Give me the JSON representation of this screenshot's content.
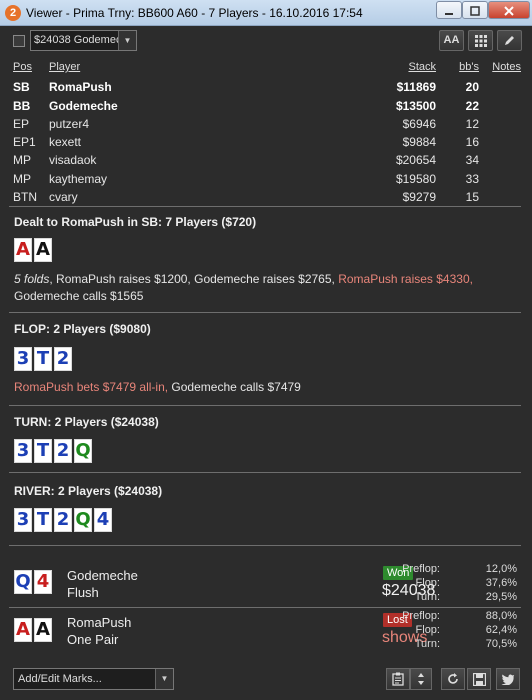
{
  "window": {
    "title": "Viewer - Prima Trny: BB600 A60 - 7 Players - 16.10.2016 17:54",
    "app_icon": "2"
  },
  "toolbar": {
    "hand_select_value": "$24038 Godemeche",
    "font_button_label": "AA"
  },
  "players_table": {
    "headers": {
      "pos": "Pos",
      "player": "Player",
      "stack": "Stack",
      "bbs": "bb's",
      "notes": "Notes"
    },
    "rows": [
      {
        "pos": "SB",
        "player": "RomaPush",
        "stack": "$11869",
        "bbs": "20",
        "bold": true
      },
      {
        "pos": "BB",
        "player": "Godemeche",
        "stack": "$13500",
        "bbs": "22",
        "bold": true
      },
      {
        "pos": "EP",
        "player": "putzer4",
        "stack": "$6946",
        "bbs": "12",
        "bold": false
      },
      {
        "pos": "EP1",
        "player": "kexett",
        "stack": "$9884",
        "bbs": "16",
        "bold": false
      },
      {
        "pos": "MP",
        "player": "visadaok",
        "stack": "$20654",
        "bbs": "34",
        "bold": false
      },
      {
        "pos": "MP",
        "player": "kaythemay",
        "stack": "$19580",
        "bbs": "33",
        "bold": false
      },
      {
        "pos": "BTN",
        "player": "cvary",
        "stack": "$9279",
        "bbs": "15",
        "bold": false
      }
    ]
  },
  "preflop": {
    "title": "Dealt to RomaPush in SB: 7 Players ($720)",
    "cards": [
      {
        "rank": "A",
        "color": "#c81e1e"
      },
      {
        "rank": "A",
        "color": "#111111"
      }
    ],
    "action_folds": "5 folds",
    "action_a": ", RomaPush raises $1200, Godemeche raises $2765, ",
    "action_hl": "RomaPush raises $4330,",
    "action_b": "Godemeche calls $1565"
  },
  "flop": {
    "title": "FLOP: 2 Players ($9080)",
    "cards": [
      {
        "rank": "3",
        "color": "#1c3fb5"
      },
      {
        "rank": "T",
        "color": "#1c3fb5"
      },
      {
        "rank": "2",
        "color": "#1c3fb5"
      }
    ],
    "action_hl": "RomaPush bets $7479 all-in,",
    "action_b": " Godemeche calls $7479"
  },
  "turn": {
    "title": "TURN: 2 Players ($24038)",
    "cards": [
      {
        "rank": "3",
        "color": "#1c3fb5"
      },
      {
        "rank": "T",
        "color": "#1c3fb5"
      },
      {
        "rank": "2",
        "color": "#1c3fb5"
      },
      {
        "rank": "Q",
        "color": "#1e8a1e"
      }
    ]
  },
  "river": {
    "title": "RIVER: 2 Players ($24038)",
    "cards": [
      {
        "rank": "3",
        "color": "#1c3fb5"
      },
      {
        "rank": "T",
        "color": "#1c3fb5"
      },
      {
        "rank": "2",
        "color": "#1c3fb5"
      },
      {
        "rank": "Q",
        "color": "#1e8a1e"
      },
      {
        "rank": "4",
        "color": "#1c3fb5"
      }
    ]
  },
  "results": [
    {
      "name": "Godemeche",
      "hand": "Flush",
      "badge": "Won",
      "amount": "$24038",
      "cards": [
        {
          "rank": "Q",
          "color": "#1c3fb5"
        },
        {
          "rank": "4",
          "color": "#c81e1e"
        }
      ],
      "stats": [
        {
          "label": "Preflop:",
          "value": "12,0%"
        },
        {
          "label": "Flop:",
          "value": "37,6%"
        },
        {
          "label": "Turn:",
          "value": "29,5%"
        }
      ]
    },
    {
      "name": "RomaPush",
      "hand": "One Pair",
      "badge": "Lost",
      "amount": "shows",
      "cards": [
        {
          "rank": "A",
          "color": "#c81e1e"
        },
        {
          "rank": "A",
          "color": "#111111"
        }
      ],
      "stats": [
        {
          "label": "Preflop:",
          "value": "88,0%"
        },
        {
          "label": "Flop:",
          "value": "62,4%"
        },
        {
          "label": "Turn:",
          "value": "70,5%"
        }
      ]
    }
  ],
  "footer": {
    "marks_placeholder": "Add/Edit Marks..."
  },
  "icons": {
    "app": "app-logo-icon",
    "grid": "grid-icon",
    "edit": "pencil-icon",
    "clipboard": "clipboard-icon",
    "updown": "up-down-arrows-icon",
    "refresh": "refresh-icon",
    "save": "save-icon",
    "twitter": "twitter-icon"
  }
}
